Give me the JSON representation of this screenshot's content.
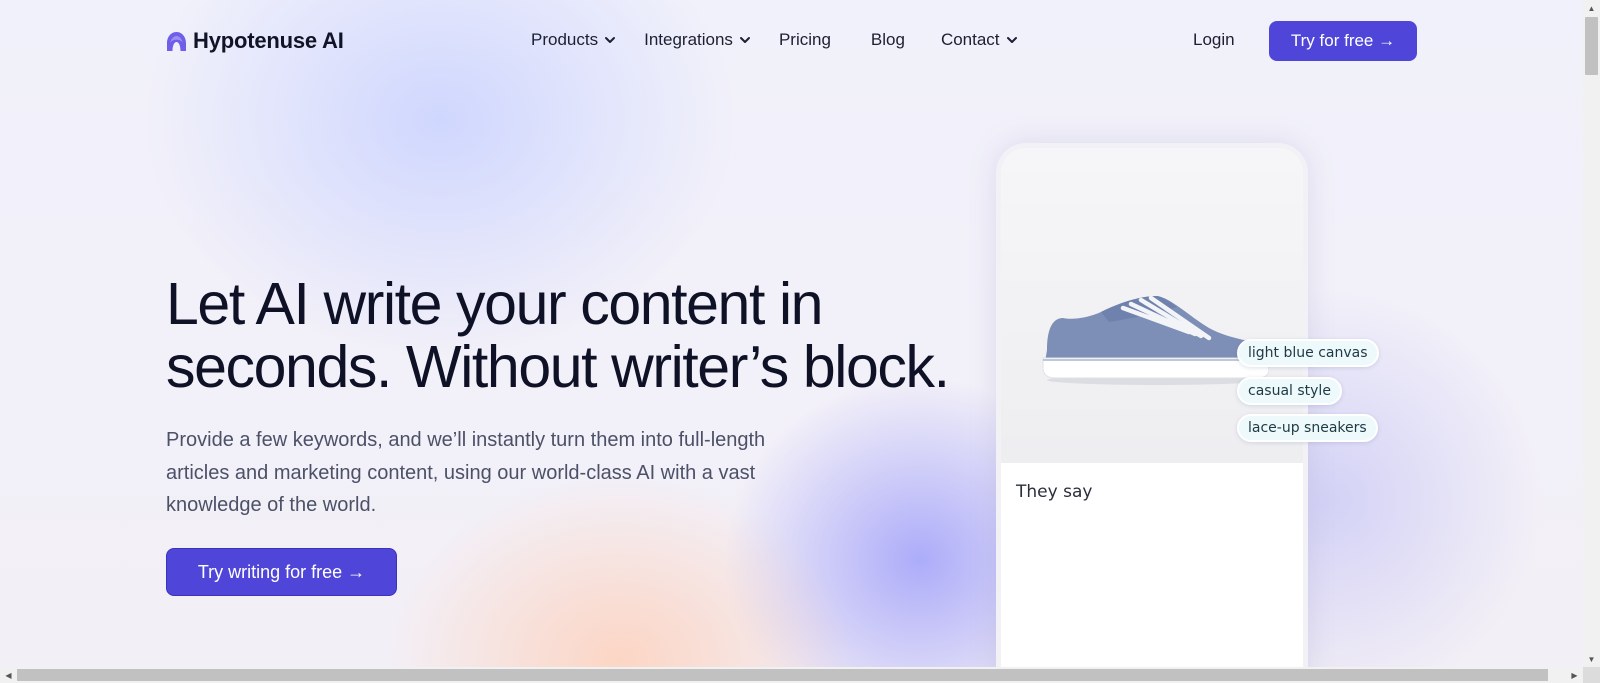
{
  "brand": {
    "name": "Hypotenuse AI",
    "logo_color": "#6e5ee8"
  },
  "nav": {
    "items": [
      {
        "label": "Products",
        "dropdown": true
      },
      {
        "label": "Integrations",
        "dropdown": true
      },
      {
        "label": "Pricing",
        "dropdown": false
      },
      {
        "label": "Blog",
        "dropdown": false
      },
      {
        "label": "Contact",
        "dropdown": true
      }
    ],
    "login_label": "Login",
    "cta_label": "Try for free →"
  },
  "hero": {
    "title_line1": "Let AI write your content in",
    "title_line2": "seconds. Without writer’s block.",
    "subtitle": "Provide a few keywords, and we’ll instantly turn them into full-length articles and marketing content, using our world-class AI with a vast knowledge of the world.",
    "cta_label": "Try writing for free →"
  },
  "mockup": {
    "tags": [
      "light blue canvas",
      "casual style",
      "lace-up sneakers"
    ],
    "output_text": "They say"
  },
  "colors": {
    "accent": "#4f46d9",
    "text_dark": "#0f1226",
    "text_muted": "#4c5168"
  }
}
